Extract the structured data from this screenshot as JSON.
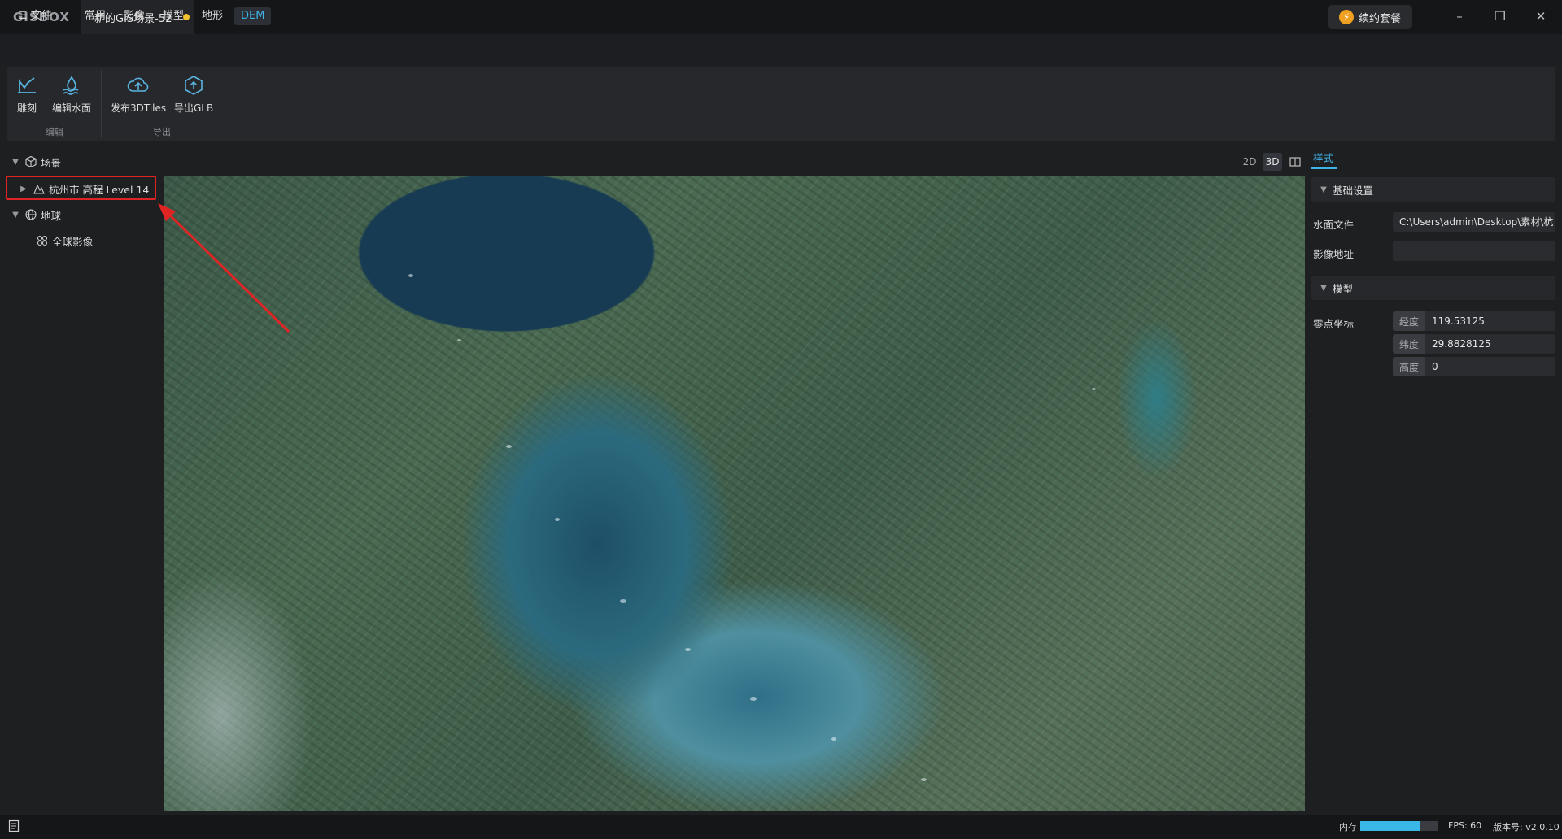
{
  "app": {
    "logo": "GISBOX"
  },
  "document_tab": {
    "title": "新的GIS场景-52",
    "unsaved_color": "#f2c12e"
  },
  "header": {
    "renew_label": "续约套餐"
  },
  "window_controls": {
    "minimize": "–",
    "restore": "❐",
    "close": "✕"
  },
  "menu": {
    "file": "文件",
    "tabs": [
      "常用",
      "影像",
      "模型",
      "地形",
      "DEM"
    ],
    "active_tab": "DEM"
  },
  "ribbon": {
    "groups": [
      {
        "label": "编辑",
        "tools": [
          {
            "label": "雕刻",
            "icon": "sculpt-icon"
          },
          {
            "label": "编辑水面",
            "icon": "water-edit-icon"
          }
        ]
      },
      {
        "label": "导出",
        "tools": [
          {
            "label": "发布3DTiles",
            "icon": "cloud-upload-icon"
          },
          {
            "label": "导出GLB",
            "icon": "hex-upload-icon"
          }
        ]
      }
    ]
  },
  "tree": {
    "scene_label": "场景",
    "scene_child": "杭州市 高程 Level 14",
    "earth_label": "地球",
    "earth_child": "全球影像"
  },
  "view_modes": {
    "mode_2d": "2D",
    "mode_3d": "3D",
    "active": "3D"
  },
  "panel": {
    "tab": "样式",
    "basic_section": "基础设置",
    "water_file_label": "水面文件",
    "water_file_value": "C:\\Users\\admin\\Desktop\\素材\\杭",
    "image_url_label": "影像地址",
    "image_url_value": "",
    "model_section": "模型",
    "origin_label": "零点坐标",
    "lon_label": "经度",
    "lon_value": "119.53125",
    "lat_label": "纬度",
    "lat_value": "29.8828125",
    "height_label": "高度",
    "height_value": "0"
  },
  "status": {
    "memory_label": "内存",
    "memory_fraction": 0.76,
    "fps": "FPS: 60",
    "version": "版本号: v2.0.10"
  },
  "colors": {
    "accent": "#3fb4e8",
    "highlight": "#e02424"
  }
}
